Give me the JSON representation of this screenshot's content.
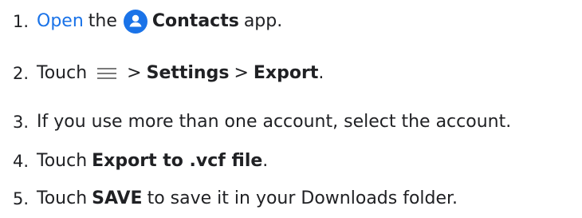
{
  "steps": [
    {
      "number": "1.",
      "link_text": "Open",
      "before_icon": "the",
      "icon": "contacts-app-icon",
      "app_name": "Contacts",
      "after": "app."
    },
    {
      "number": "2.",
      "lead": "Touch",
      "icon": "menu-icon",
      "sep1": ">",
      "settings": "Settings",
      "sep2": ">",
      "export": "Export",
      "end": "."
    },
    {
      "number": "3.",
      "text": "If you use more than one account, select the account."
    },
    {
      "number": "4.",
      "lead": "Touch",
      "bold": "Export to .vcf file",
      "end": "."
    },
    {
      "number": "5.",
      "lead": "Touch",
      "bold": "SAVE",
      "rest": "to save it in your Downloads folder."
    }
  ],
  "colors": {
    "link": "#1a73e8",
    "icon_bg": "#1a73e8",
    "menu_icon": "#7a7a7a",
    "text": "#202124"
  }
}
